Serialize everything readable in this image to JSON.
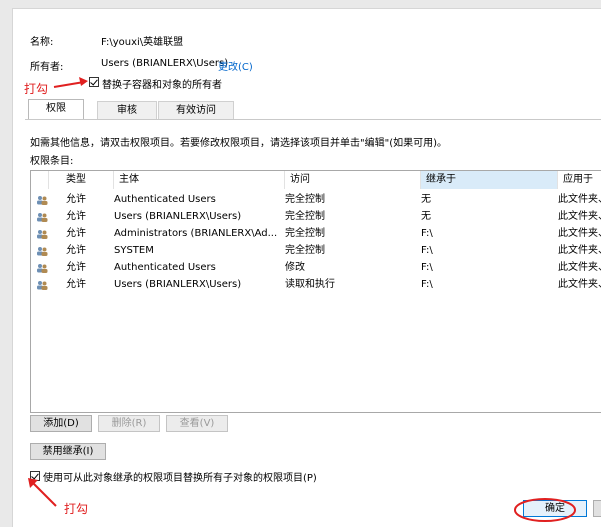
{
  "header": {
    "name_label": "名称:",
    "name_value": "F:\\youxi\\英雄联盟",
    "owner_label": "所有者:",
    "owner_value": "Users (BRIANLERX\\Users)",
    "change_link": "更改(C)",
    "replace_owner_checkbox": "替换子容器和对象的所有者"
  },
  "tabs": [
    {
      "label": "权限"
    },
    {
      "label": "审核"
    },
    {
      "label": "有效访问"
    }
  ],
  "info_text": "如需其他信息，请双击权限项目。若要修改权限项目，请选择该项目并单击\"编辑\"(如果可用)。",
  "entries_label": "权限条目:",
  "table": {
    "columns": [
      "类型",
      "主体",
      "访问",
      "继承于",
      "应用于"
    ],
    "rows": [
      {
        "type": "允许",
        "principal": "Authenticated Users",
        "access": "完全控制",
        "inherited": "无",
        "applies": "此文件夹、子"
      },
      {
        "type": "允许",
        "principal": "Users (BRIANLERX\\Users)",
        "access": "完全控制",
        "inherited": "无",
        "applies": "此文件夹、子"
      },
      {
        "type": "允许",
        "principal": "Administrators (BRIANLERX\\Ad...",
        "access": "完全控制",
        "inherited": "F:\\",
        "applies": "此文件夹、子"
      },
      {
        "type": "允许",
        "principal": "SYSTEM",
        "access": "完全控制",
        "inherited": "F:\\",
        "applies": "此文件夹、子"
      },
      {
        "type": "允许",
        "principal": "Authenticated Users",
        "access": "修改",
        "inherited": "F:\\",
        "applies": "此文件夹、子"
      },
      {
        "type": "允许",
        "principal": "Users (BRIANLERX\\Users)",
        "access": "读取和执行",
        "inherited": "F:\\",
        "applies": "此文件夹、子"
      }
    ]
  },
  "buttons": {
    "add": "添加(D)",
    "remove": "删除(R)",
    "view": "查看(V)",
    "disable_inheritance": "禁用继承(I)",
    "ok": "确定"
  },
  "replace_child_checkbox": "使用可从此对象继承的权限项目替换所有子对象的权限项目(P)",
  "annotations": {
    "top": "打勾",
    "bottom": "打勾"
  },
  "colors": {
    "annotation": "#e02020",
    "link": "#0066cc",
    "sorted_header": "#d9ebf9"
  }
}
